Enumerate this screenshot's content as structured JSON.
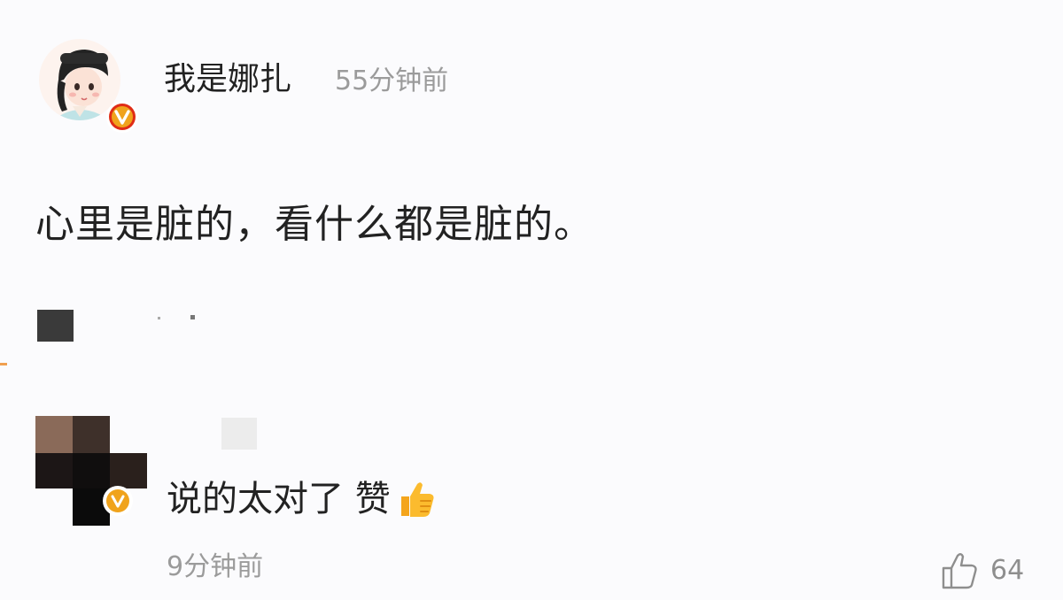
{
  "post": {
    "username": "我是娜扎",
    "time": "55分钟前",
    "verified_badge": "v-badge",
    "comment": "心里是脏的，看什么都是脏的。"
  },
  "reply": {
    "text": "说的太对了 赞",
    "emoji": "thumbs-up-emoji",
    "time": "9分钟前",
    "likes": "64"
  },
  "colors": {
    "background": "#fbfbfd",
    "muted_text": "#9b9b9b",
    "badge_orange": "#f0a31c",
    "badge_red": "#e02c16"
  }
}
